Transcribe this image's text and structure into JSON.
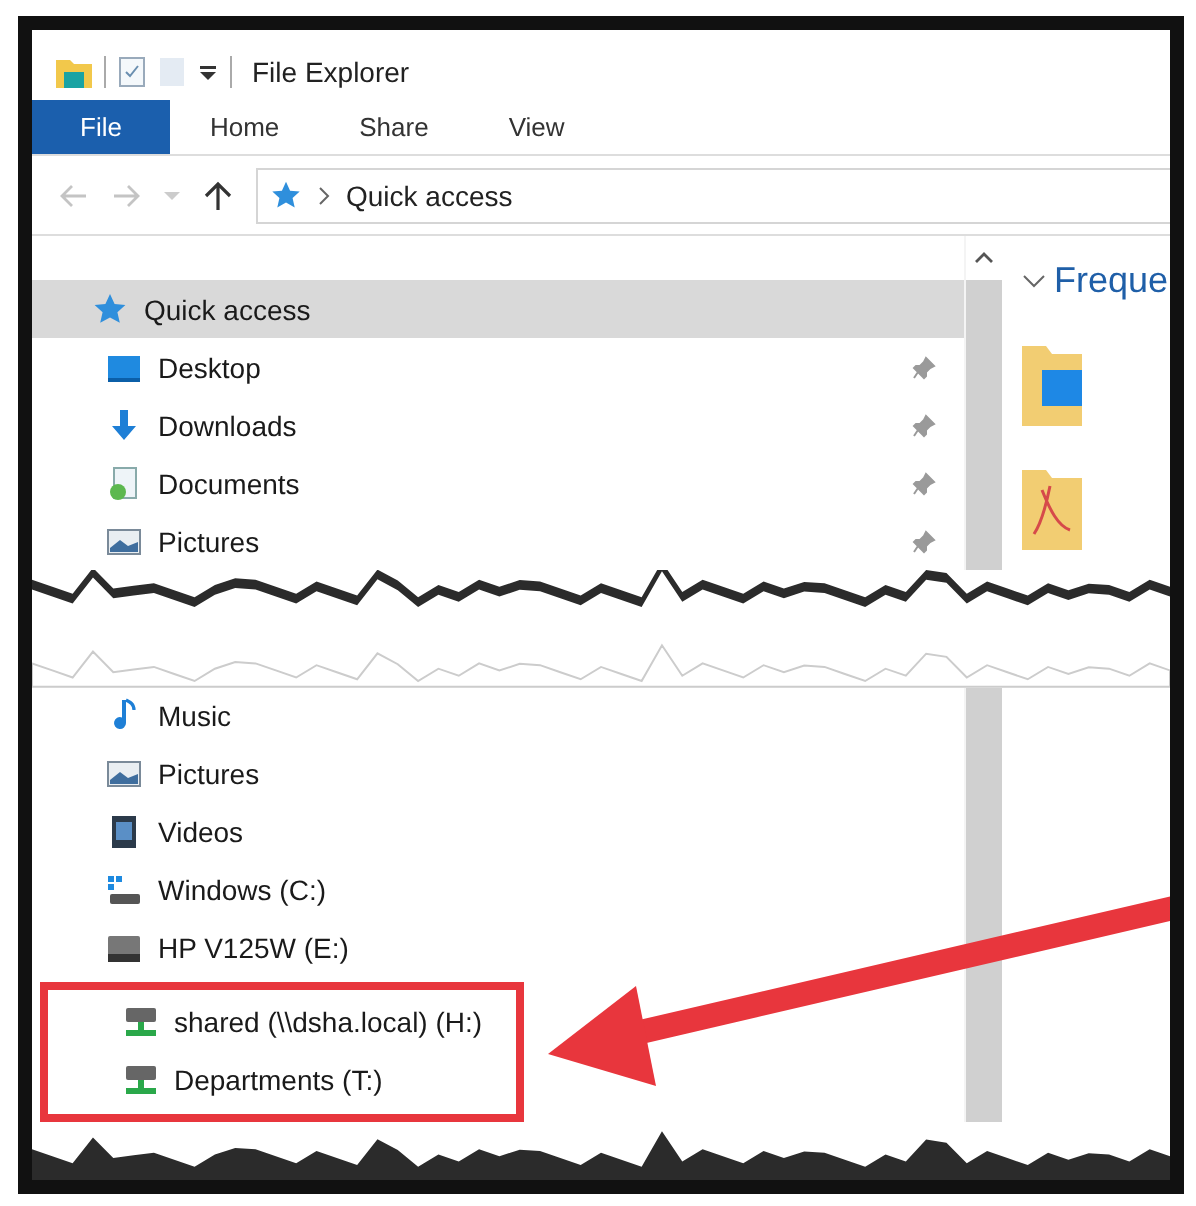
{
  "window": {
    "title": "File Explorer"
  },
  "ribbon_tabs": [
    {
      "label": "File",
      "selected": true
    },
    {
      "label": "Home",
      "selected": false
    },
    {
      "label": "Share",
      "selected": false
    },
    {
      "label": "View",
      "selected": false
    }
  ],
  "address_bar": {
    "path": "Quick access"
  },
  "navigation_pane": {
    "upper_items": [
      {
        "label": "Quick access",
        "kind": "star",
        "selected": true,
        "pinned": false
      },
      {
        "label": "Desktop",
        "kind": "desktop",
        "selected": false,
        "pinned": true
      },
      {
        "label": "Downloads",
        "kind": "download",
        "selected": false,
        "pinned": true
      },
      {
        "label": "Documents",
        "kind": "documents",
        "selected": false,
        "pinned": true
      },
      {
        "label": "Pictures",
        "kind": "pictures",
        "selected": false,
        "pinned": true
      }
    ],
    "lower_items": [
      {
        "label": "Music",
        "kind": "music",
        "highlighted": false
      },
      {
        "label": "Pictures",
        "kind": "pictures",
        "highlighted": false
      },
      {
        "label": "Videos",
        "kind": "videos",
        "highlighted": false
      },
      {
        "label": "Windows (C:)",
        "kind": "system-drive",
        "highlighted": false
      },
      {
        "label": "HP V125W (E:)",
        "kind": "drive",
        "highlighted": false
      },
      {
        "label": "shared (\\\\dsha.local) (H:)",
        "kind": "network-drive",
        "highlighted": true
      },
      {
        "label": "Departments (T:)",
        "kind": "network-drive",
        "highlighted": true
      }
    ]
  },
  "content_pane": {
    "group_header": "Freque"
  }
}
